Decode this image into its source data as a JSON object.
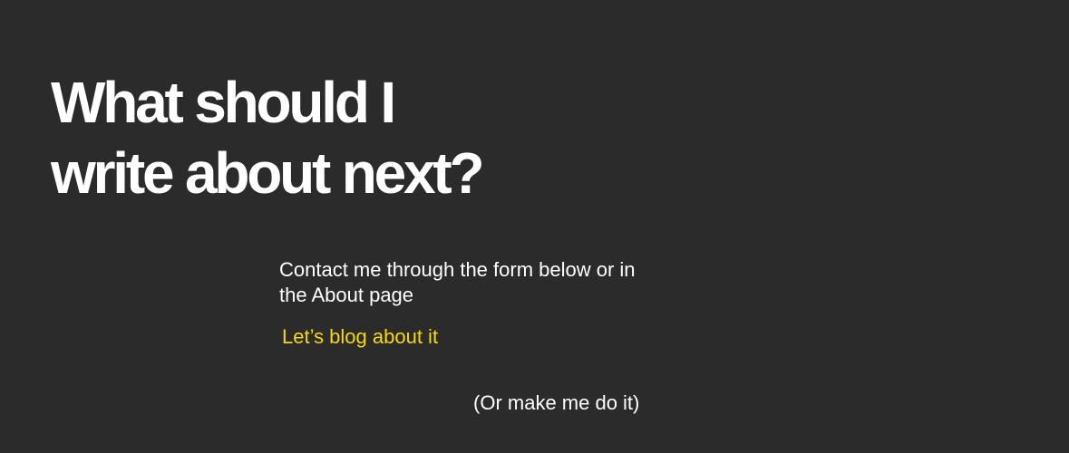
{
  "hero": {
    "headline_line1": "What should I",
    "headline_line2": "write about next?"
  },
  "contact": {
    "body_line1": "Contact me through the form below or in",
    "body_line2": "the About page",
    "cta_label": "Let’s blog about it",
    "fallback_label": "(Or make me do it)"
  },
  "colors": {
    "background": "#2b2b2b",
    "text": "#ffffff",
    "accent": "#f5d90a"
  }
}
